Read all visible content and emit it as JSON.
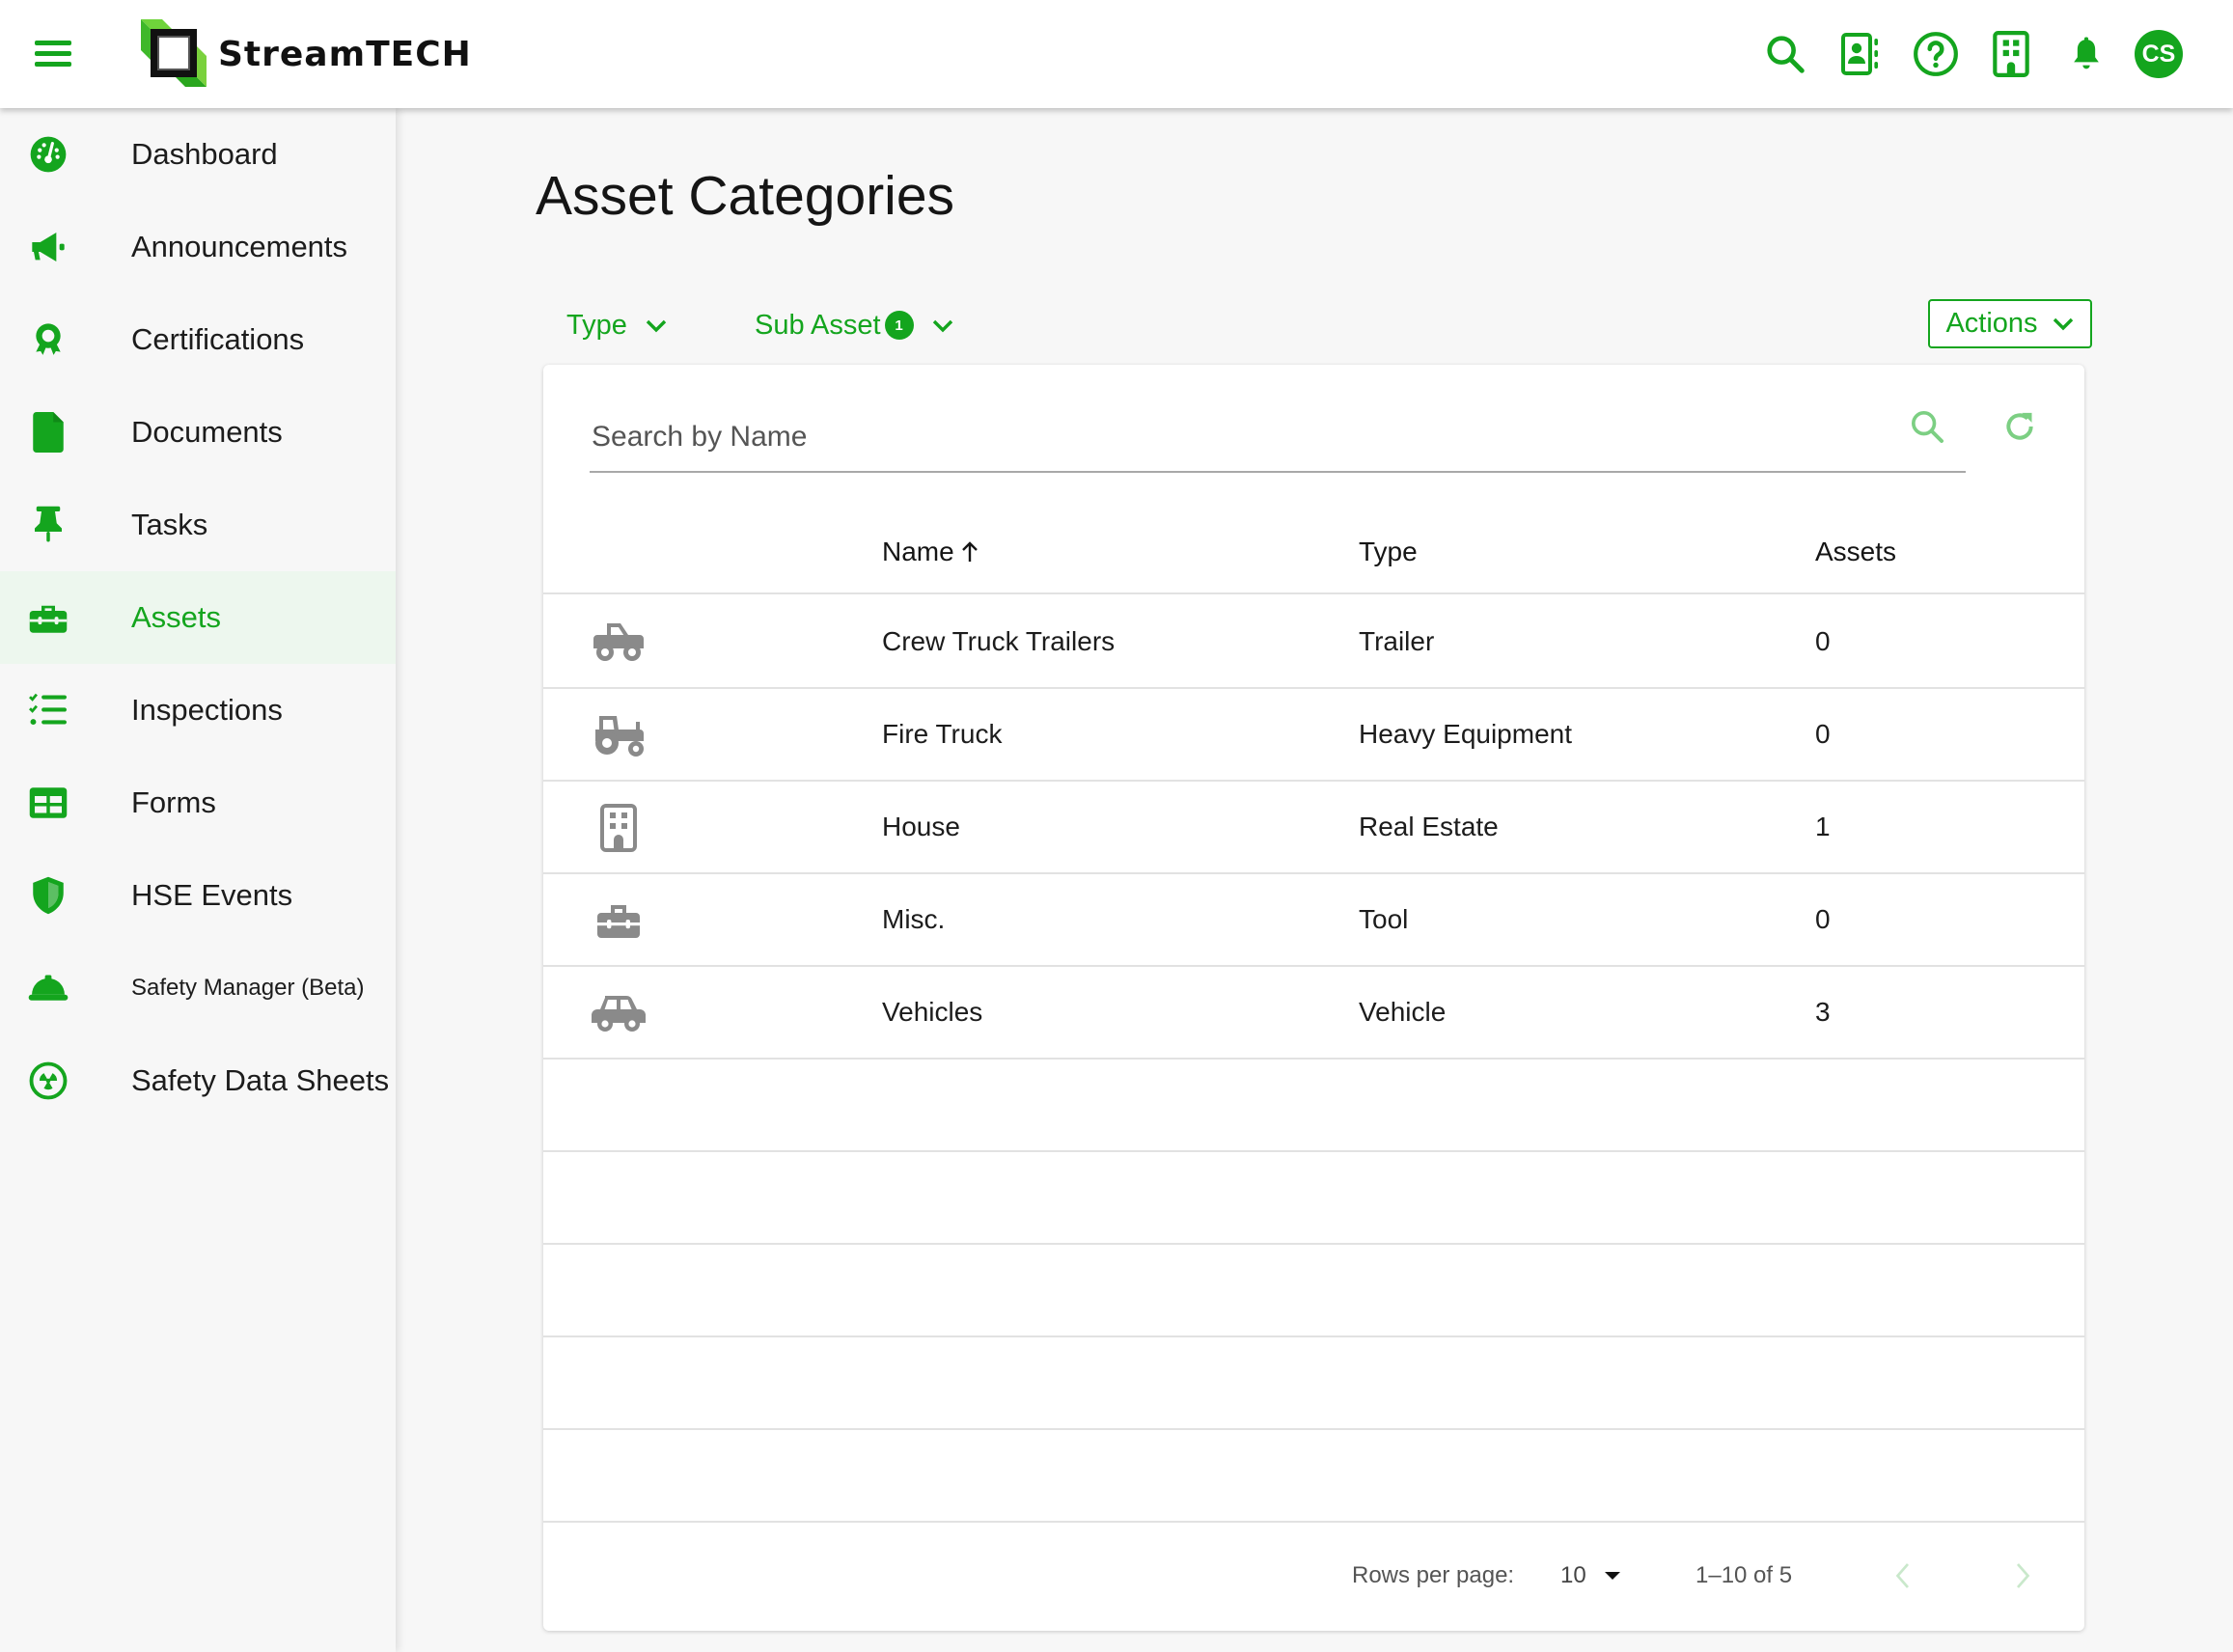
{
  "header": {
    "brand": "StreamTECH",
    "menu_icon": "hamburger-menu-icon",
    "icons": [
      {
        "name": "search-icon"
      },
      {
        "name": "contacts-icon"
      },
      {
        "name": "help-icon"
      },
      {
        "name": "building-icon"
      },
      {
        "name": "notifications-bell-icon"
      }
    ],
    "avatar_initials": "CS"
  },
  "colors": {
    "accent": "#14a51e",
    "active_bg": "#edf7ee",
    "row_icon": "#8a8a8a"
  },
  "sidebar": {
    "items": [
      {
        "label": "Dashboard",
        "icon": "dashboard-gauge-icon",
        "active": false
      },
      {
        "label": "Announcements",
        "icon": "megaphone-icon",
        "active": false
      },
      {
        "label": "Certifications",
        "icon": "award-ribbon-icon",
        "active": false
      },
      {
        "label": "Documents",
        "icon": "document-icon",
        "active": false
      },
      {
        "label": "Tasks",
        "icon": "pushpin-icon",
        "active": false
      },
      {
        "label": "Assets",
        "icon": "toolbox-icon",
        "active": true
      },
      {
        "label": "Inspections",
        "icon": "checklist-icon",
        "active": false
      },
      {
        "label": "Forms",
        "icon": "table-form-icon",
        "active": false
      },
      {
        "label": "HSE Events",
        "icon": "shield-icon",
        "active": false
      },
      {
        "label": "Safety Manager (Beta)",
        "icon": "hard-hat-icon",
        "active": false
      },
      {
        "label": "Safety Data Sheets",
        "icon": "hazard-radiation-icon",
        "active": false
      }
    ]
  },
  "main": {
    "title": "Asset Categories",
    "filters": [
      {
        "label": "Type",
        "badge": null
      },
      {
        "label": "Sub Asset",
        "badge": "1"
      }
    ],
    "actions_label": "Actions",
    "search": {
      "placeholder": "Search by Name",
      "value": ""
    },
    "table": {
      "columns": [
        {
          "label": "Name",
          "sort": "asc",
          "sort_icon": "arrow-up-icon"
        },
        {
          "label": "Type"
        },
        {
          "label": "Assets"
        }
      ],
      "rows": [
        {
          "icon": "pickup-truck-icon",
          "name": "Crew Truck Trailers",
          "type": "Trailer",
          "assets": "0"
        },
        {
          "icon": "tractor-icon",
          "name": "Fire Truck",
          "type": "Heavy Equipment",
          "assets": "0"
        },
        {
          "icon": "building-icon",
          "name": "House",
          "type": "Real Estate",
          "assets": "1"
        },
        {
          "icon": "toolbox-icon",
          "name": "Misc.",
          "type": "Tool",
          "assets": "0"
        },
        {
          "icon": "car-icon",
          "name": "Vehicles",
          "type": "Vehicle",
          "assets": "3"
        }
      ],
      "empty_rows": 5
    },
    "pagination": {
      "rows_per_page_label": "Rows per page:",
      "rows_per_page": "10",
      "range": "1–10 of 5"
    }
  }
}
